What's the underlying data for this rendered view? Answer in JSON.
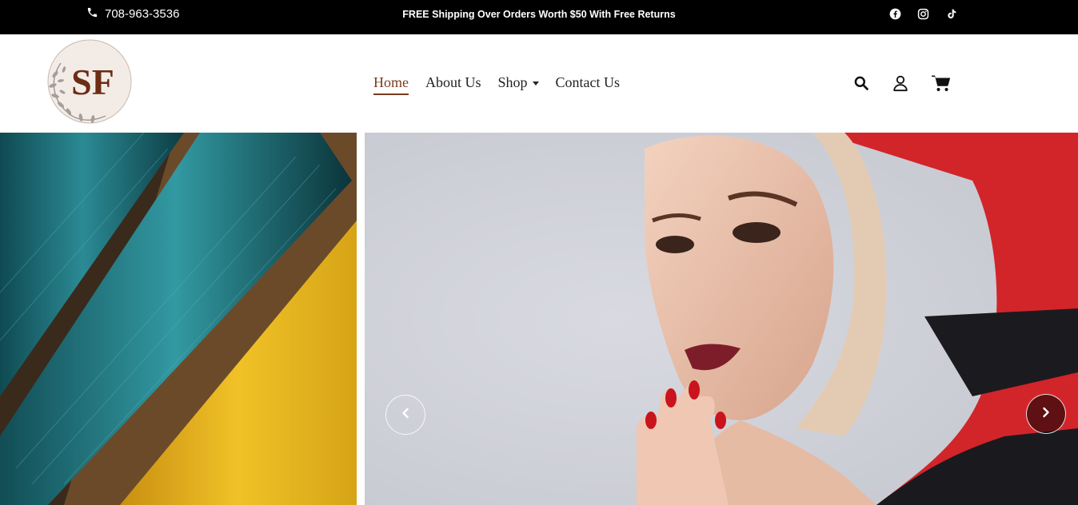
{
  "topbar": {
    "phone": "708-963-3536",
    "promo": "FREE Shipping Over Orders Worth $50 With Free Returns",
    "social": [
      "facebook-icon",
      "instagram-icon",
      "tiktok-icon"
    ]
  },
  "logo": {
    "text": "SF"
  },
  "nav": {
    "items": [
      {
        "label": "Home",
        "active": true
      },
      {
        "label": "About Us"
      },
      {
        "label": "Shop",
        "has_dropdown": true
      },
      {
        "label": "Contact Us"
      }
    ]
  },
  "header_icons": [
    "search-icon",
    "user-icon",
    "cart-icon"
  ],
  "hero": {
    "left_image": "teal and yellow silk fabric rolls",
    "slide_image": "woman wearing red floral silk headscarf",
    "controls": [
      "prev-slide-button",
      "next-slide-button"
    ]
  },
  "colors": {
    "topbar_bg": "#000000",
    "accent": "#7a3b1d",
    "logo_bg": "#f3ece6"
  }
}
